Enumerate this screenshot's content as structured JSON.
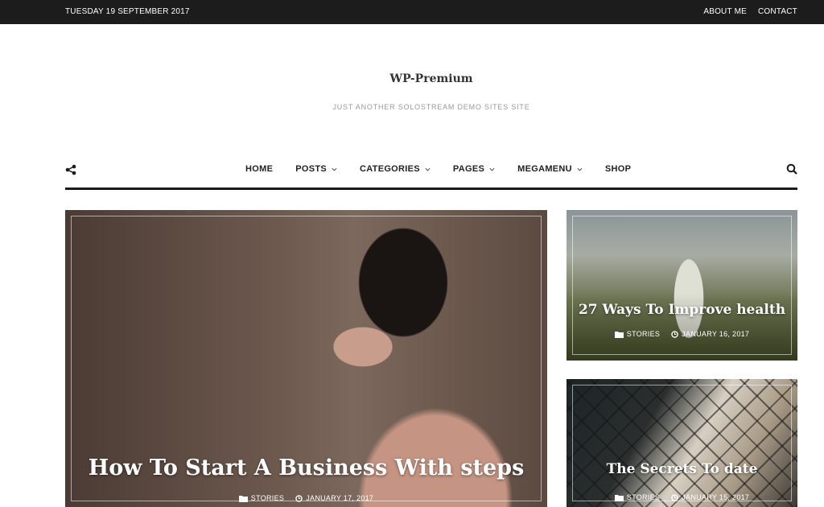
{
  "topbar": {
    "date": "TUESDAY 19 SEPTEMBER 2017",
    "links": [
      "ABOUT ME",
      "CONTACT"
    ]
  },
  "site": {
    "title": "WP-Premium",
    "tagline": "JUST ANOTHER SOLOSTREAM DEMO SITES SITE"
  },
  "nav": {
    "items": [
      {
        "label": "HOME",
        "dropdown": false
      },
      {
        "label": "POSTS",
        "dropdown": true
      },
      {
        "label": "CATEGORIES",
        "dropdown": true
      },
      {
        "label": "PAGES",
        "dropdown": true
      },
      {
        "label": "MEGAMENU",
        "dropdown": true
      },
      {
        "label": "SHOP",
        "dropdown": false
      }
    ],
    "icons": {
      "left": "share-icon",
      "right": "search-icon"
    }
  },
  "featured": {
    "main": {
      "title": "How To Start A Business With steps",
      "category": "STORIES",
      "date": "JANUARY 17, 2017"
    },
    "side1": {
      "title": "27 Ways To Improve health",
      "category": "STORIES",
      "date": "JANUARY 16, 2017"
    },
    "side2": {
      "title": "The Secrets To date",
      "category": "STORIES",
      "date": "JANUARY 15, 2017"
    }
  }
}
